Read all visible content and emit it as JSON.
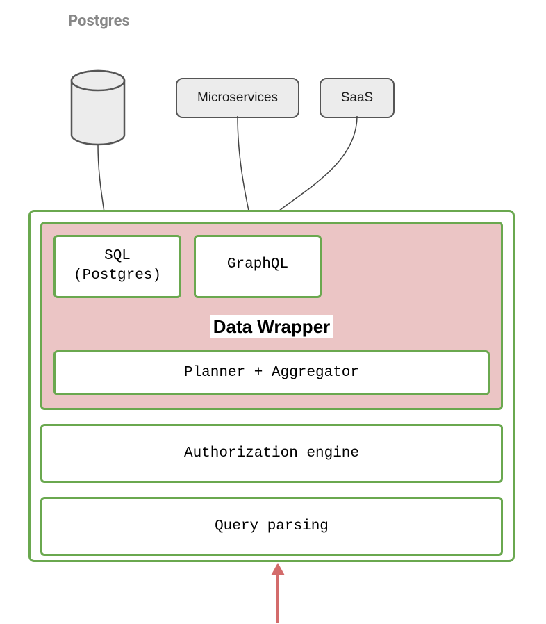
{
  "title": "Postgres",
  "sources": {
    "database": {
      "type": "cylinder",
      "label": "Postgres"
    },
    "microservices": "Microservices",
    "saas": "SaaS"
  },
  "container": {
    "wrapper": {
      "sql": {
        "line1": "SQL",
        "line2": "(Postgres)"
      },
      "graphql": "GraphQL",
      "title": "Data Wrapper",
      "planner": "Planner + Aggregator"
    },
    "authorization": "Authorization engine",
    "query_parsing": "Query parsing"
  },
  "colors": {
    "border_green": "#6aa84f",
    "wrapper_bg": "#ebc5c5",
    "source_bg": "#ececec",
    "source_border": "#555555",
    "title_gray": "#888888",
    "arrow": "#d36b6b"
  }
}
